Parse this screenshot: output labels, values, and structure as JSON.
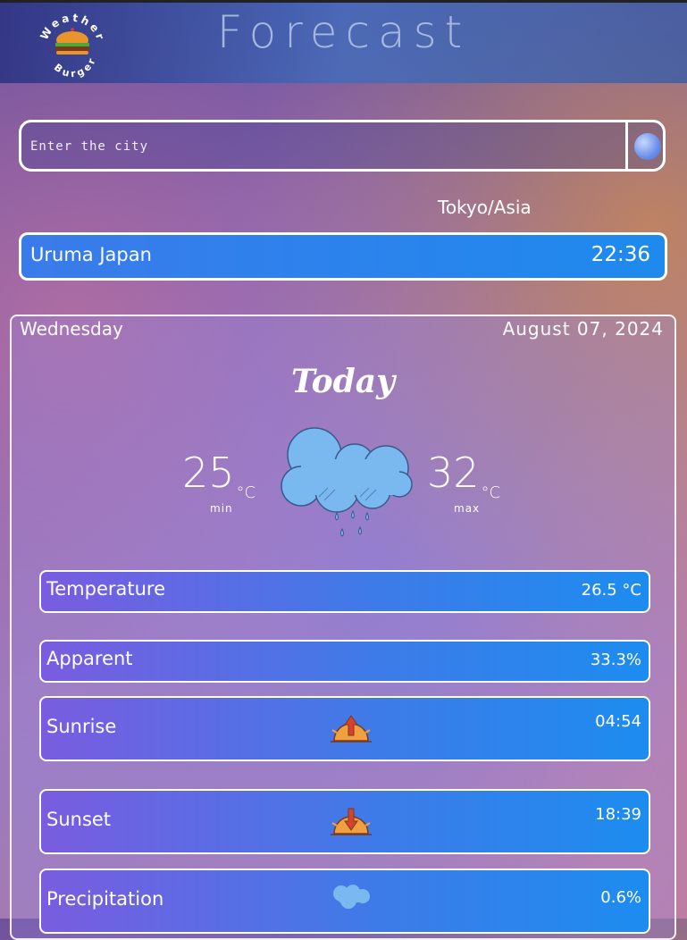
{
  "header": {
    "logo_text": "Weather Burger",
    "title": "Forecast"
  },
  "search": {
    "placeholder": "Enter the city",
    "value": "",
    "button_icon": "globe-icon"
  },
  "timezone": "Tokyo/Asia",
  "location": {
    "name": "Uruma Japan",
    "time": "22:36"
  },
  "forecast": {
    "day": "Wednesday",
    "date": "August 07, 2024",
    "heading": "Today",
    "min_temp": "25",
    "max_temp": "32",
    "unit": "°C",
    "min_label": "min",
    "max_label": "max",
    "condition_icon": "rain-cloud-icon"
  },
  "stats": [
    {
      "label": "Temperature",
      "value": "26.5 °C"
    },
    {
      "label": "Apparent",
      "value": "33.3%"
    },
    {
      "label": "Sunrise",
      "value": "04:54",
      "icon": "sunrise-icon"
    },
    {
      "label": "Sunset",
      "value": "18:39",
      "icon": "sunset-icon"
    },
    {
      "label": "Precipitation",
      "value": "0.6%",
      "icon": "rain-cloud-icon"
    }
  ],
  "colors": {
    "accent_blue": "#1e8aee",
    "accent_purple": "#7a5ce0",
    "cloud_blue": "#7ab8f0"
  }
}
